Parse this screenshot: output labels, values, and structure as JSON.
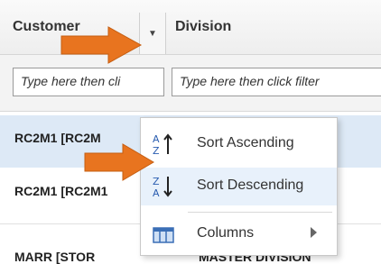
{
  "header": {
    "customer": "Customer",
    "division": "Division"
  },
  "filter": {
    "customer_placeholder": "Type here then cli",
    "division_placeholder": "Type here then click filter"
  },
  "rows": [
    {
      "customer": "RC2M1 [RC2M",
      "division": ""
    },
    {
      "customer": "RC2M1 [RC2M1",
      "division": ""
    },
    {
      "customer": "MARR [STOR",
      "division": "MASTER DIVISION"
    }
  ],
  "menu": {
    "sort_asc": "Sort Ascending",
    "sort_desc": "Sort Descending",
    "columns": "Columns"
  },
  "colors": {
    "accent_arrow": "#e8741f",
    "selected_row": "#dde9f6",
    "hover_item": "#e8f1fb"
  },
  "icons": [
    "sort-ascending-icon",
    "sort-descending-icon",
    "columns-icon",
    "submenu-arrow-icon",
    "dropdown-trigger-icon"
  ]
}
